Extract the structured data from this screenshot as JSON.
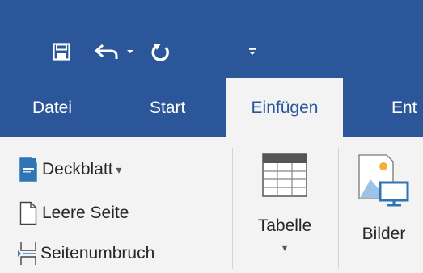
{
  "quick_access": {
    "save_icon": "floppy-disk-icon",
    "undo_icon": "undo-arrow-icon",
    "undo_dropdown_icon": "chevron-down-icon",
    "redo_icon": "redo-circular-arrow-icon",
    "customize_icon": "customize-qat-icon"
  },
  "tabs": [
    {
      "label": "Datei",
      "active": false
    },
    {
      "label": "Start",
      "active": false
    },
    {
      "label": "Einfügen",
      "active": true
    },
    {
      "label": "Ent",
      "active": false
    }
  ],
  "ribbon": {
    "pages_group": {
      "cover_page": {
        "label": "Deckblatt",
        "icon": "cover-page-icon",
        "dropdown": "▾"
      },
      "blank_page": {
        "label": "Leere Seite",
        "icon": "blank-page-icon"
      },
      "page_break": {
        "label": "Seitenumbruch",
        "icon": "page-break-icon"
      }
    },
    "table": {
      "label": "Tabelle",
      "icon": "table-grid-icon",
      "dropdown": "▾"
    },
    "pictures": {
      "label": "Bilder",
      "icon": "pictures-icon"
    }
  },
  "colors": {
    "title_bar": "#2b579a",
    "ribbon_bg": "#f3f3f3",
    "active_tab_text": "#2b579a",
    "accent_blue": "#2e75b6"
  }
}
